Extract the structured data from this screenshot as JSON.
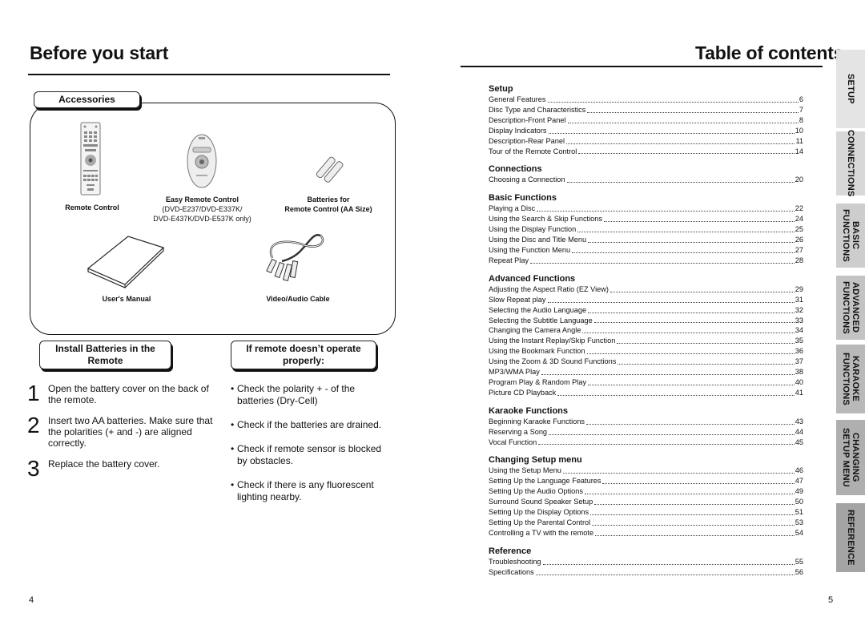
{
  "left_page": {
    "title": "Before you start",
    "page_number": "4",
    "accessories": {
      "label": "Accessories",
      "items": [
        {
          "name": "Remote Control",
          "note": ""
        },
        {
          "name": "Easy Remote Control",
          "note": "(DVD-E237/DVD-E337K/",
          "note2": "DVD-E437K/DVD-E537K only)"
        },
        {
          "name": "Batteries for",
          "note": "Remote Control (AA Size)"
        },
        {
          "name": "User's Manual"
        },
        {
          "name": "Video/Audio Cable"
        }
      ]
    },
    "install": {
      "label_line1": "Install Batteries in the",
      "label_line2": "Remote",
      "steps": [
        {
          "num": "1",
          "text": "Open the battery cover on the back of the remote."
        },
        {
          "num": "2",
          "text": "Insert two AA batteries. Make sure that the polarities (+ and -) are aligned correctly."
        },
        {
          "num": "3",
          "text": "Replace the battery cover."
        }
      ]
    },
    "troubleshoot": {
      "label_line1": "If remote doesn’t operate",
      "label_line2": "properly:",
      "bullet": "•",
      "items": [
        "Check the polarity + - of the batteries (Dry-Cell)",
        "Check if the batteries are drained.",
        "Check if remote sensor is blocked by obstacles.",
        "Check if there is any fluorescent lighting nearby."
      ]
    }
  },
  "right_page": {
    "title": "Table of contents",
    "page_number": "5",
    "sections": [
      {
        "heading": "Setup",
        "entries": [
          {
            "title": "General Features",
            "page": "6"
          },
          {
            "title": "Disc Type and Characteristics",
            "page": "7"
          },
          {
            "title": "Description-Front Panel",
            "page": "8"
          },
          {
            "title": "Display Indicators",
            "page": "10"
          },
          {
            "title": "Description-Rear Panel",
            "page": "11"
          },
          {
            "title": "Tour of the Remote Control",
            "page": "14"
          }
        ]
      },
      {
        "heading": "Connections",
        "entries": [
          {
            "title": "Choosing a Connection",
            "page": "20"
          }
        ]
      },
      {
        "heading": "Basic Functions",
        "entries": [
          {
            "title": "Playing a Disc",
            "page": "22"
          },
          {
            "title": "Using the Search & Skip Functions",
            "page": "24"
          },
          {
            "title": "Using the Display Function",
            "page": "25"
          },
          {
            "title": "Using the Disc and Title Menu",
            "page": "26"
          },
          {
            "title": "Using the Function Menu",
            "page": "27"
          },
          {
            "title": "Repeat Play",
            "page": "28"
          }
        ]
      },
      {
        "heading": "Advanced Functions",
        "entries": [
          {
            "title": "Adjusting the Aspect Ratio (EZ View)",
            "page": "29"
          },
          {
            "title": "Slow Repeat play",
            "page": "31"
          },
          {
            "title": "Selecting the Audio Language",
            "page": "32"
          },
          {
            "title": "Selecting the Subtitle Language",
            "page": "33"
          },
          {
            "title": "Changing the Camera Angle",
            "page": "34"
          },
          {
            "title": "Using the Instant Replay/Skip Function",
            "page": "35"
          },
          {
            "title": "Using the Bookmark Function",
            "page": "36"
          },
          {
            "title": "Using the Zoom & 3D Sound Functions",
            "page": "37"
          },
          {
            "title": "MP3/WMA Play",
            "page": "38"
          },
          {
            "title": "Program Play & Random Play",
            "page": "40"
          },
          {
            "title": "Picture CD Playback",
            "page": "41"
          }
        ]
      },
      {
        "heading": "Karaoke Functions",
        "entries": [
          {
            "title": "Beginning Karaoke Functions",
            "page": "43"
          },
          {
            "title": "Reserving a Song",
            "page": "44"
          },
          {
            "title": "Vocal Function",
            "page": "45"
          }
        ]
      },
      {
        "heading": "Changing Setup menu",
        "entries": [
          {
            "title": "Using the Setup Menu",
            "page": "46"
          },
          {
            "title": "Setting Up the Language Features",
            "page": "47"
          },
          {
            "title": "Setting Up the Audio Options",
            "page": "49"
          },
          {
            "title": "Surround Sound Speaker Setup",
            "page": "50"
          },
          {
            "title": "Setting Up the Display Options",
            "page": "51"
          },
          {
            "title": "Setting Up the Parental Control",
            "page": "53"
          },
          {
            "title": "Controlling a TV with the remote",
            "page": "54"
          }
        ]
      },
      {
        "heading": "Reference",
        "entries": [
          {
            "title": "Troubleshooting",
            "page": "55"
          },
          {
            "title": "Specifications",
            "page": "56"
          }
        ]
      }
    ],
    "tabs": [
      {
        "line1": "SETUP",
        "line2": "",
        "color": "#e4e4e4"
      },
      {
        "line1": "CONNECTIONS",
        "line2": "",
        "color": "#d8d8d8"
      },
      {
        "line1": "BASIC",
        "line2": "FUNCTIONS",
        "color": "#cdcdcd"
      },
      {
        "line1": "ADVANCED",
        "line2": "FUNCTIONS",
        "color": "#c3c3c3"
      },
      {
        "line1": "KARAOKE",
        "line2": "FUNCTIONS",
        "color": "#b9b9b9"
      },
      {
        "line1": "CHANGING",
        "line2": "SETUP MENU",
        "color": "#afafaf"
      },
      {
        "line1": "REFERENCE",
        "line2": "",
        "color": "#a4a4a4"
      }
    ]
  }
}
